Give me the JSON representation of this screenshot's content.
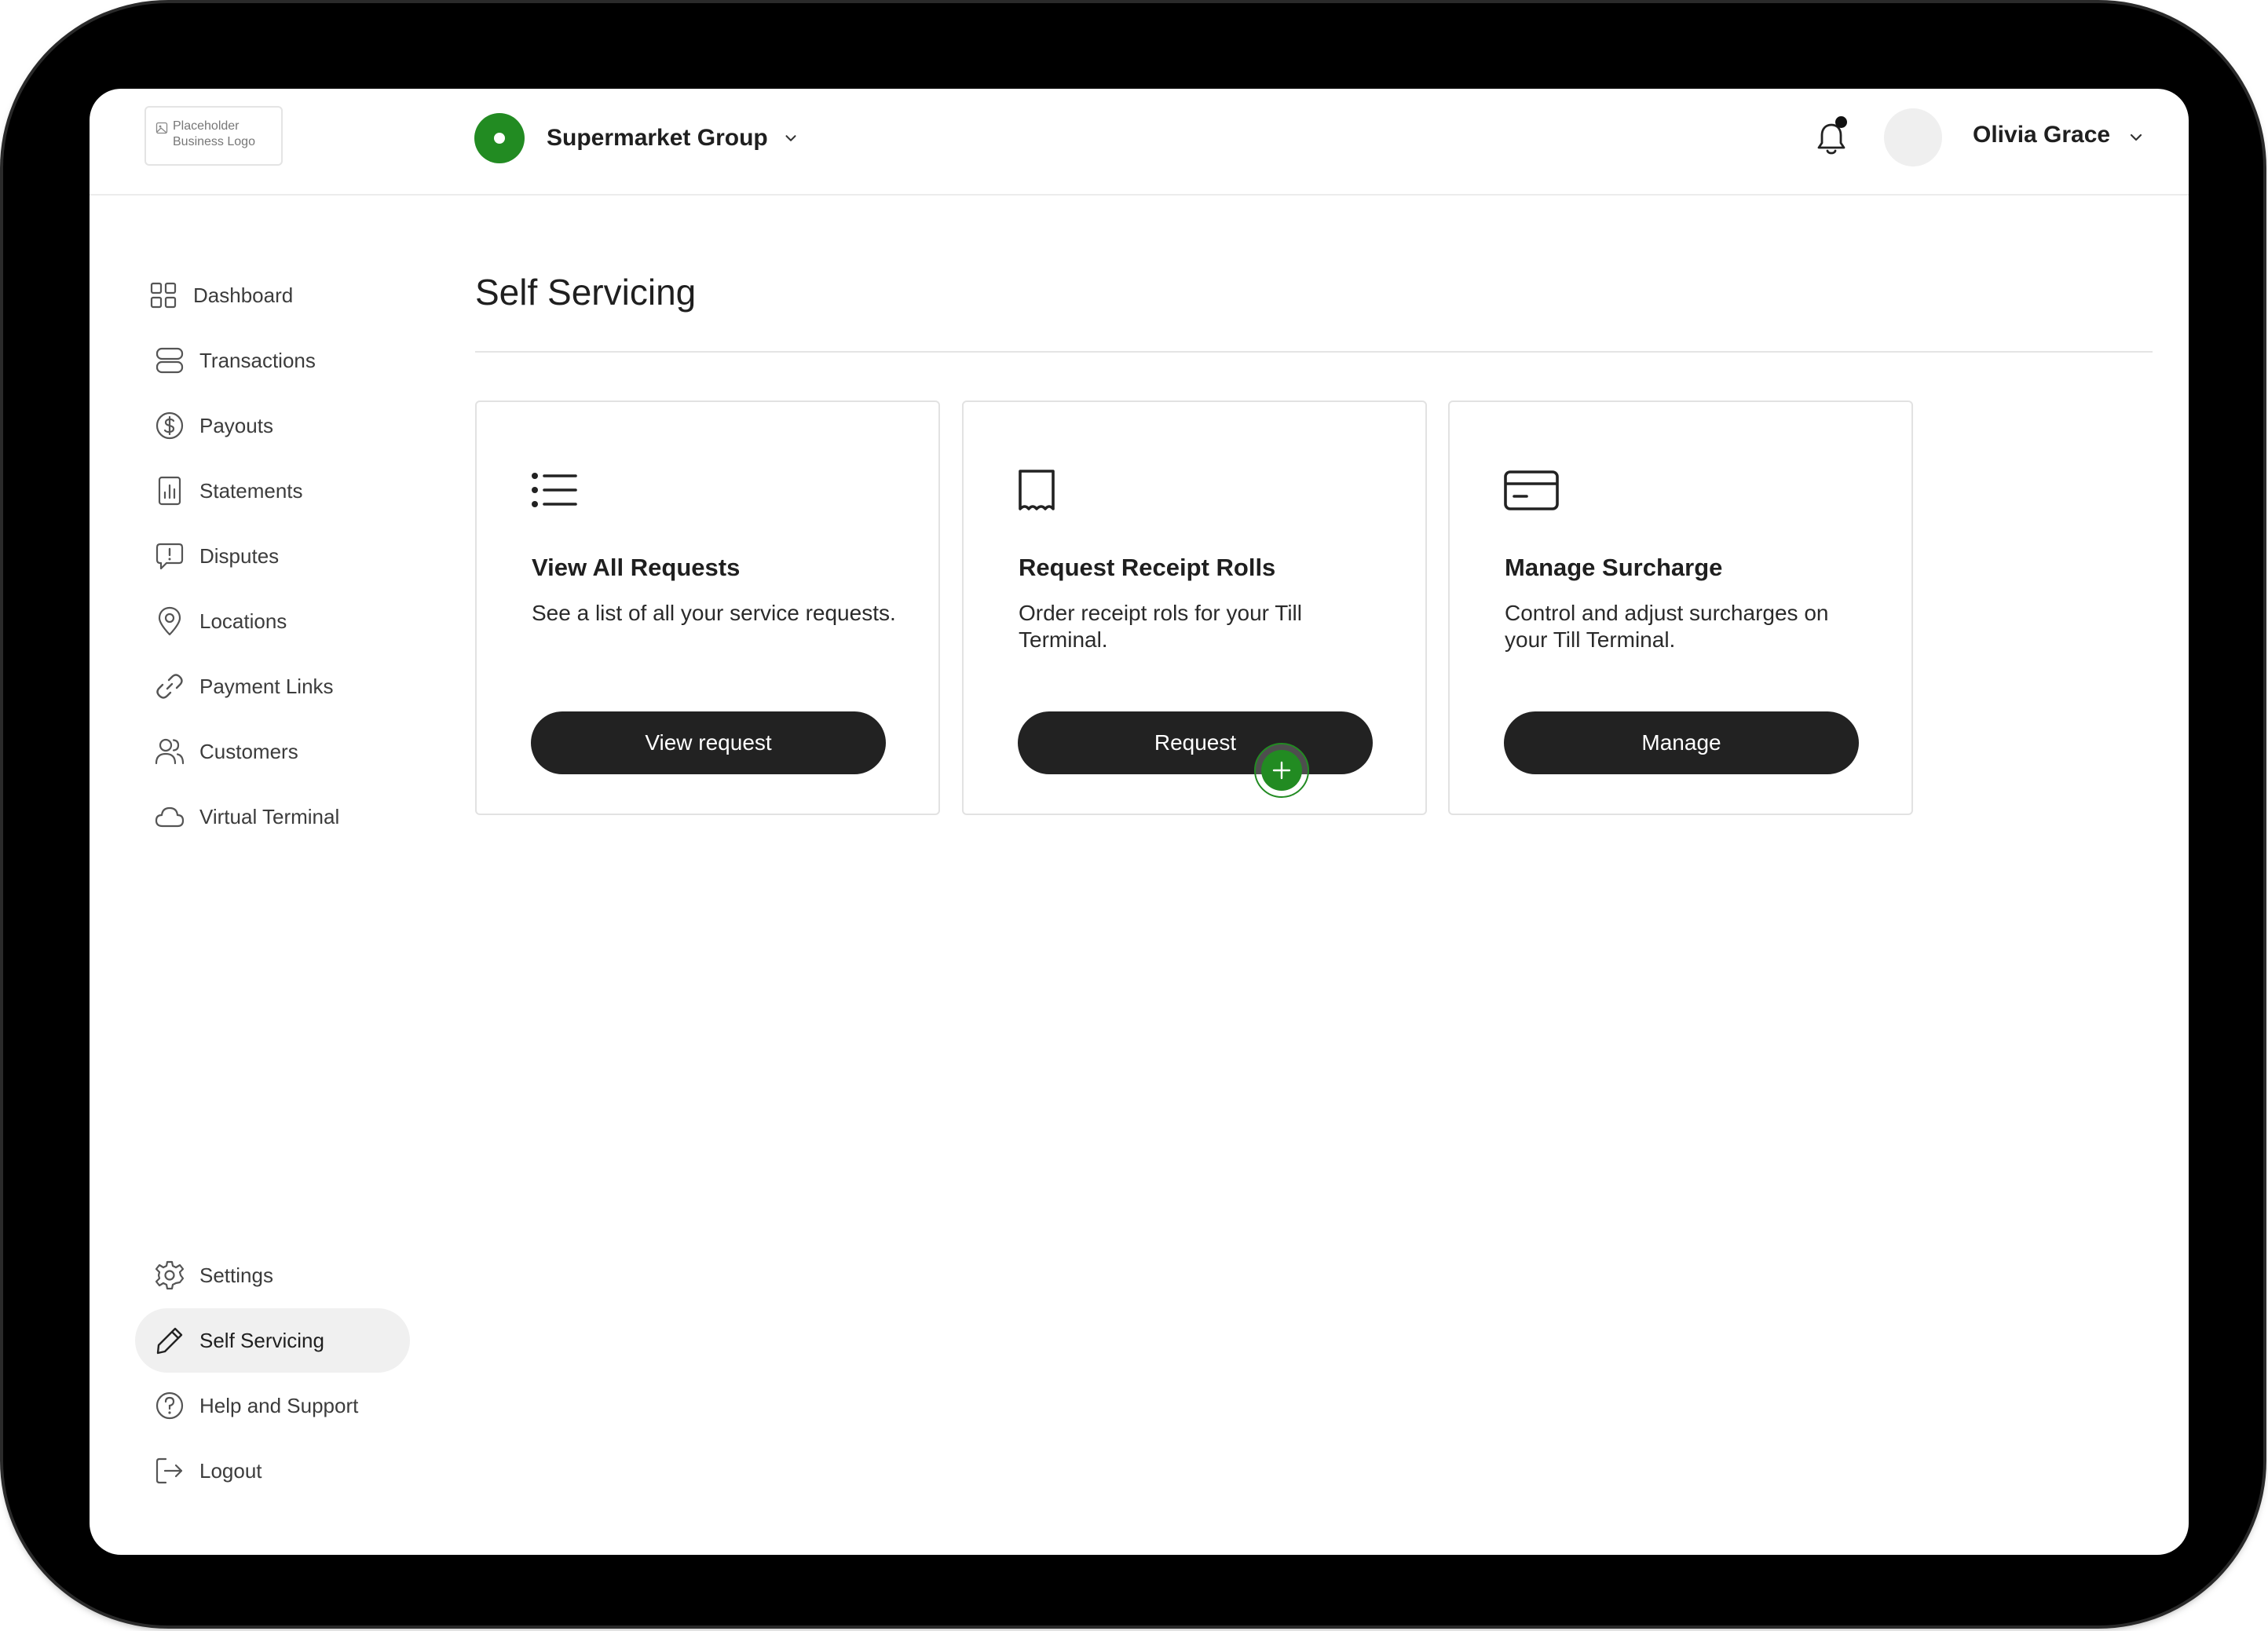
{
  "header": {
    "logo_text": "Placeholder\nBusiness Logo",
    "org_name": "Supermarket Group",
    "user_name": "Olivia Grace",
    "brand_color": "#228b22"
  },
  "sidebar": {
    "items": [
      {
        "label": "Dashboard",
        "icon": "grid-icon"
      },
      {
        "label": "Transactions",
        "icon": "transactions-icon"
      },
      {
        "label": "Payouts",
        "icon": "dollar-circle-icon"
      },
      {
        "label": "Statements",
        "icon": "bar-chart-icon"
      },
      {
        "label": "Disputes",
        "icon": "alert-message-icon"
      },
      {
        "label": "Locations",
        "icon": "map-pin-icon"
      },
      {
        "label": "Payment Links",
        "icon": "link-icon"
      },
      {
        "label": "Customers",
        "icon": "users-icon"
      },
      {
        "label": "Virtual Terminal",
        "icon": "cloud-icon"
      }
    ],
    "bottom_items": [
      {
        "label": "Settings",
        "icon": "gear-icon"
      },
      {
        "label": "Self Servicing",
        "icon": "pencil-icon",
        "active": true
      },
      {
        "label": "Help and Support",
        "icon": "help-circle-icon"
      },
      {
        "label": "Logout",
        "icon": "logout-icon"
      }
    ]
  },
  "main": {
    "title": "Self Servicing",
    "cards": [
      {
        "title": "View All Requests",
        "description": "See a list of all your service requests.",
        "button": "View request",
        "icon": "list-icon"
      },
      {
        "title": "Request Receipt Rolls",
        "description": "Order receipt rols for your Till Terminal.",
        "button": "Request",
        "icon": "receipt-icon"
      },
      {
        "title": "Manage Surcharge",
        "description": "Control and adjust surcharges on your Till Terminal.",
        "button": "Manage",
        "icon": "credit-card-icon"
      }
    ]
  }
}
